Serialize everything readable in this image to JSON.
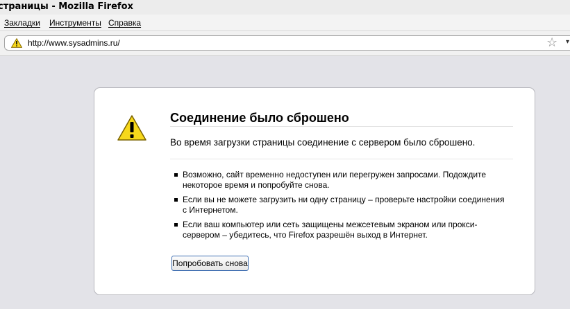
{
  "window": {
    "title": "страницы - Mozilla Firefox"
  },
  "menu": {
    "items": [
      "Закладки",
      "Инструменты",
      "Справка"
    ]
  },
  "navbar": {
    "url": "http://www.sysadmins.ru/"
  },
  "icons": {
    "warning": "warning-triangle-icon",
    "bookmark": "star-icon",
    "dropdown": "chevron-down-icon"
  },
  "colors": {
    "warning_yellow": "#f7d81b",
    "button_border": "#3c6cb0"
  },
  "error": {
    "title": "Соединение было сброшено",
    "description": "Во время загрузки страницы соединение с сервером было сброшено.",
    "bullets": [
      "Возможно, сайт временно недоступен или перегружен запросами. Подождите некоторое время и попробуйте снова.",
      "Если вы не можете загрузить ни одну страницу – проверьте настройки соединения с Интернетом.",
      "Если ваш компьютер или сеть защищены межсетевым экраном или прокси-сервером – убедитесь, что Firefox разрешён выход в Интернет."
    ],
    "retry_label": "Попробовать снова"
  }
}
